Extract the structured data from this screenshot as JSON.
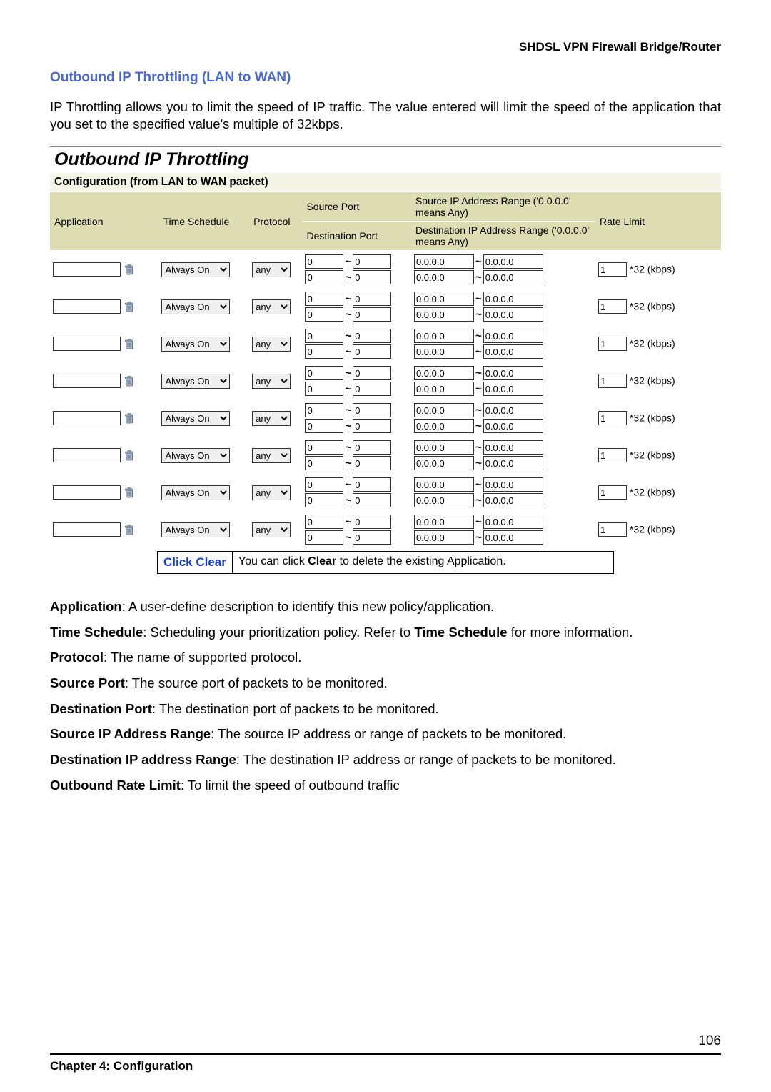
{
  "productHeader": "SHDSL VPN Firewall Bridge/Router",
  "sectionTitle": "Outbound IP Throttling (LAN to WAN)",
  "intro": "IP Throttling allows you to limit the speed of IP traffic. The value entered will limit the speed of the application that you set to the specified value's multiple of 32kbps.",
  "panelTitle": "Outbound IP Throttling",
  "subtitle": "Configuration (from LAN to WAN packet)",
  "headers": {
    "application": "Application",
    "timeSchedule": "Time Schedule",
    "protocol": "Protocol",
    "sourcePort": "Source Port",
    "destPort": "Destination Port",
    "srcIPRange": "Source IP Address Range ('0.0.0.0' means Any)",
    "dstIPRange": "Destination IP Address Range ('0.0.0.0' means Any)",
    "rateLimit": "Rate Limit"
  },
  "timeScheduleValue": "Always On",
  "protocolValue": "any",
  "portDefault": "0",
  "ipDefault": "0.0.0.0",
  "rateDefault": "1",
  "rateUnit": "*32 (kbps)",
  "rowCount": 8,
  "callout": {
    "label": "Click Clear",
    "text_pre": "You can click ",
    "bold": "Clear",
    "text_post": " to delete the existing Application."
  },
  "descriptions": [
    {
      "label": "Application",
      "text": ": A user-define description to identify this new policy/application."
    },
    {
      "label": "Time Schedule",
      "text": ": Scheduling your prioritization policy. Refer to ",
      "bold2": "Time Schedule",
      "text2": " for more information."
    },
    {
      "label": "Protocol",
      "text": ": The name of supported protocol."
    },
    {
      "label": "Source Port",
      "text": ": The source port of packets to be monitored."
    },
    {
      "label": "Destination Port",
      "text": ": The destination port of packets to be monitored."
    },
    {
      "label": "Source IP Address Range",
      "text": ": The source IP address or range of packets to be monitored."
    },
    {
      "label": "Destination IP address Range",
      "text": ": The destination IP address or range of packets to be monitored."
    },
    {
      "label": "Outbound Rate Limit",
      "text": ": To limit the speed of outbound traffic"
    }
  ],
  "footer": {
    "chapter": "Chapter 4: Configuration",
    "page": "106"
  }
}
